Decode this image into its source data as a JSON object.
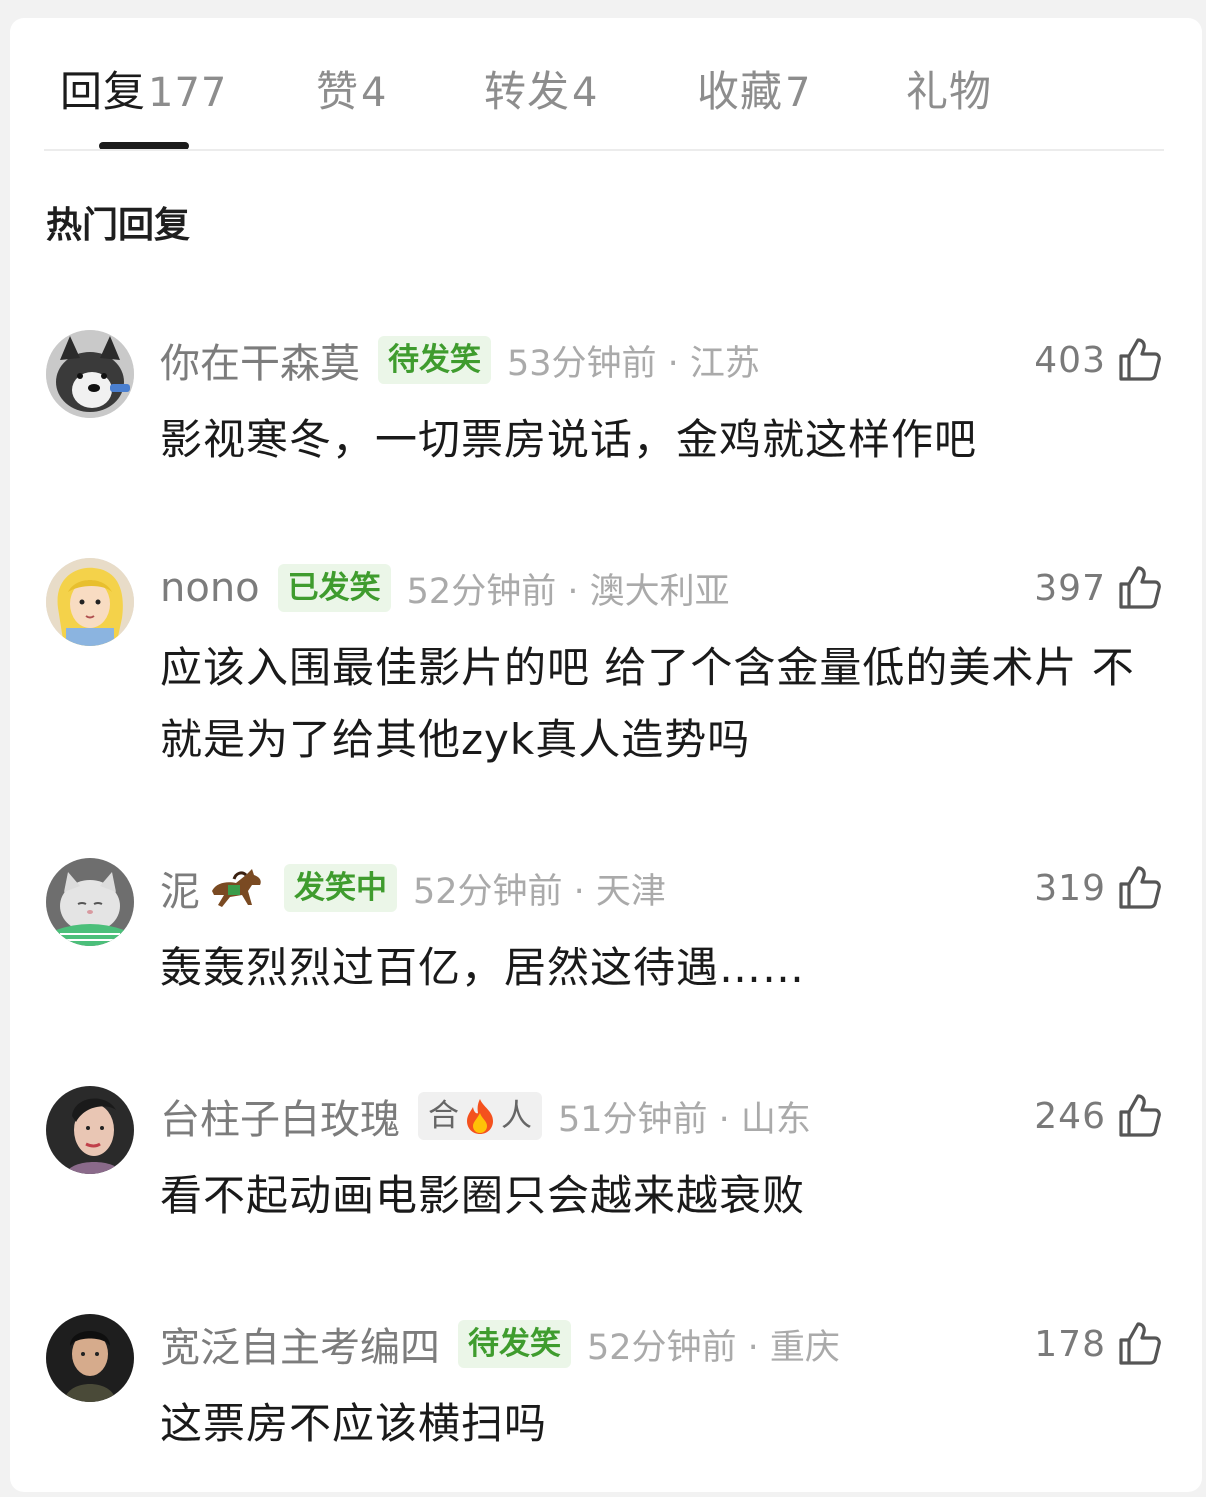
{
  "tabs": [
    {
      "label": "回复",
      "count": "177"
    },
    {
      "label": "赞",
      "count": "4"
    },
    {
      "label": "转发",
      "count": "4"
    },
    {
      "label": "收藏",
      "count": "7"
    },
    {
      "label": "礼物",
      "count": ""
    }
  ],
  "section_title": "热门回复",
  "comments": [
    {
      "username": "你在干森莫",
      "badge": "待发笑",
      "time": "53分钟前 · 江苏",
      "likes": "403",
      "text": "影视寒冬，一切票房说话，金鸡就这样作吧"
    },
    {
      "username": "nono",
      "badge": "已发笑",
      "time": "52分钟前 · 澳大利亚",
      "likes": "397",
      "text": "应该入围最佳影片的吧 给了个含金量低的美术片 不就是为了给其他zyk真人造势吗"
    },
    {
      "username": "泥",
      "badge": "发笑中",
      "time": "52分钟前 · 天津",
      "likes": "319",
      "text": "轰轰烈烈过百亿，居然这待遇……"
    },
    {
      "username": "台柱子白玫瑰",
      "badge_left": "合",
      "badge_right": "人",
      "time": "51分钟前 · 山东",
      "likes": "246",
      "text": "看不起动画电影圈只会越来越衰败"
    },
    {
      "username": "宽泛自主考编四",
      "badge": "待发笑",
      "time": "52分钟前 · 重庆",
      "likes": "178",
      "text": "这票房不应该横扫吗"
    }
  ],
  "icons": {
    "like": "thumbs-up-icon",
    "horse": "horse-emoji-icon",
    "fire": "fire-emoji-icon"
  },
  "colors": {
    "badge_green": "#3f9c2e",
    "badge_bg": "#ebf6e8",
    "muted": "#8d8d8d"
  }
}
